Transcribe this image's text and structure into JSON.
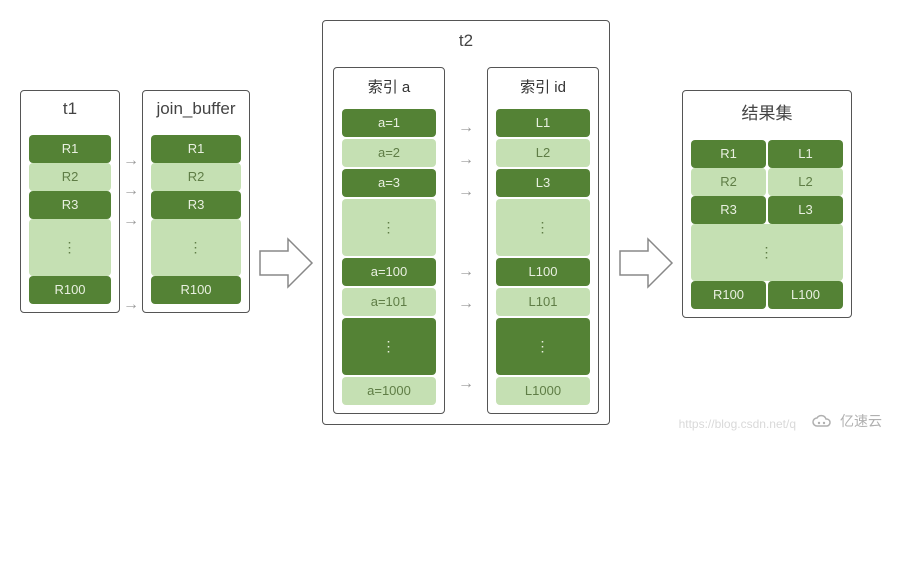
{
  "panels": {
    "t1": {
      "title": "t1"
    },
    "join_buffer": {
      "title": "join_buffer"
    },
    "t2": {
      "title": "t2",
      "col_a": "索引 a",
      "col_id": "索引 id"
    },
    "results": {
      "title": "结果集"
    }
  },
  "rows": {
    "r1": "R1",
    "r2": "R2",
    "r3": "R3",
    "r100": "R100",
    "l1": "L1",
    "l2": "L2",
    "l3": "L3",
    "l100": "L100",
    "l101": "L101",
    "l1000": "L1000",
    "a1": "a=1",
    "a2": "a=2",
    "a3": "a=3",
    "a100": "a=100",
    "a101": "a=101",
    "a1000": "a=1000",
    "dots": "⋮"
  },
  "watermark": {
    "url": "https://blog.csdn.net/q",
    "brand": "亿速云"
  },
  "icons": {
    "arrow": "→"
  }
}
